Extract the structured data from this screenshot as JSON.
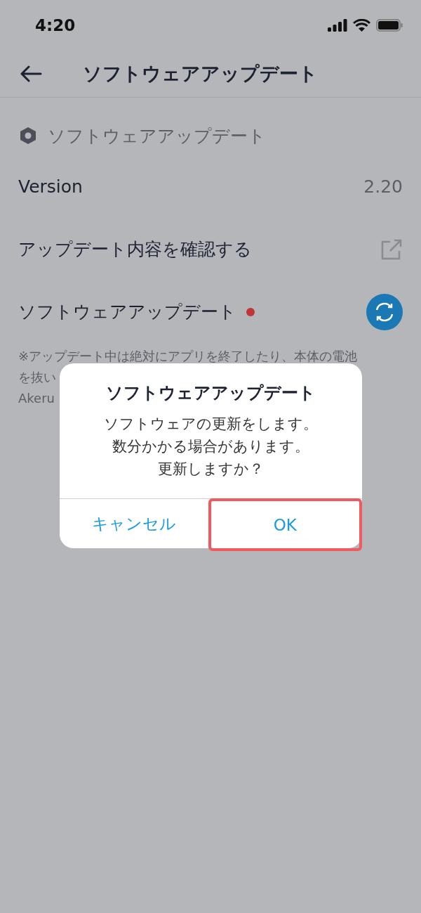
{
  "status_bar": {
    "time": "4:20"
  },
  "header": {
    "title": "ソフトウェアアップデート"
  },
  "section": {
    "title": "ソフトウェアアップデート"
  },
  "rows": [
    {
      "kind": "value",
      "label": "Version",
      "value": "2.20"
    },
    {
      "kind": "link",
      "label": "アップデート内容を確認する"
    },
    {
      "kind": "update",
      "label": "ソフトウェアアップデート",
      "badge": true
    }
  ],
  "note": {
    "lines": [
      "※アップデート中は絶対にアプリを終了したり、本体の電池",
      "を抜い",
      "Akeru"
    ]
  },
  "dialog": {
    "title": "ソフトウェアアップデート",
    "message": [
      "ソフトウェアの更新をします。",
      "数分かかる場合があります。",
      "更新しますか？"
    ],
    "buttons": [
      {
        "label": "キャンセル",
        "highlighted": false
      },
      {
        "label": "OK",
        "highlighted": true
      }
    ]
  }
}
